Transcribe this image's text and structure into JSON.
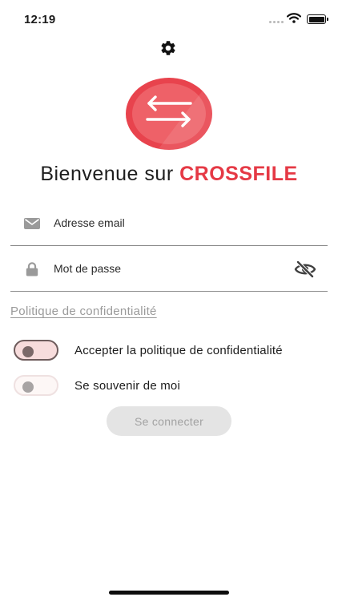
{
  "status_bar": {
    "time": "12:19"
  },
  "header": {
    "welcome_text": "Bienvenue sur",
    "brand_name": "CROSSFILE"
  },
  "form": {
    "email": {
      "placeholder": "Adresse email",
      "value": ""
    },
    "password": {
      "placeholder": "Mot de passe",
      "value": ""
    },
    "privacy_link": "Politique de confidentialité",
    "accept_privacy": {
      "label": "Accepter la politique de confidentialité",
      "checked": false
    },
    "remember_me": {
      "label": "Se souvenir de moi",
      "checked": false
    },
    "login_button": "Se connecter"
  },
  "icons": {
    "settings": "gear-icon",
    "logo": "swap-arrows-logo",
    "email": "envelope-icon",
    "password": "lock-icon",
    "visibility": "eye-off-icon"
  },
  "colors": {
    "brand": "#e53945",
    "logo_outer": "#e8434d",
    "logo_inner": "#ef6a70",
    "button_bg": "#e4e4e4",
    "button_text": "#a2a2a2",
    "link": "#9a9a9a"
  }
}
